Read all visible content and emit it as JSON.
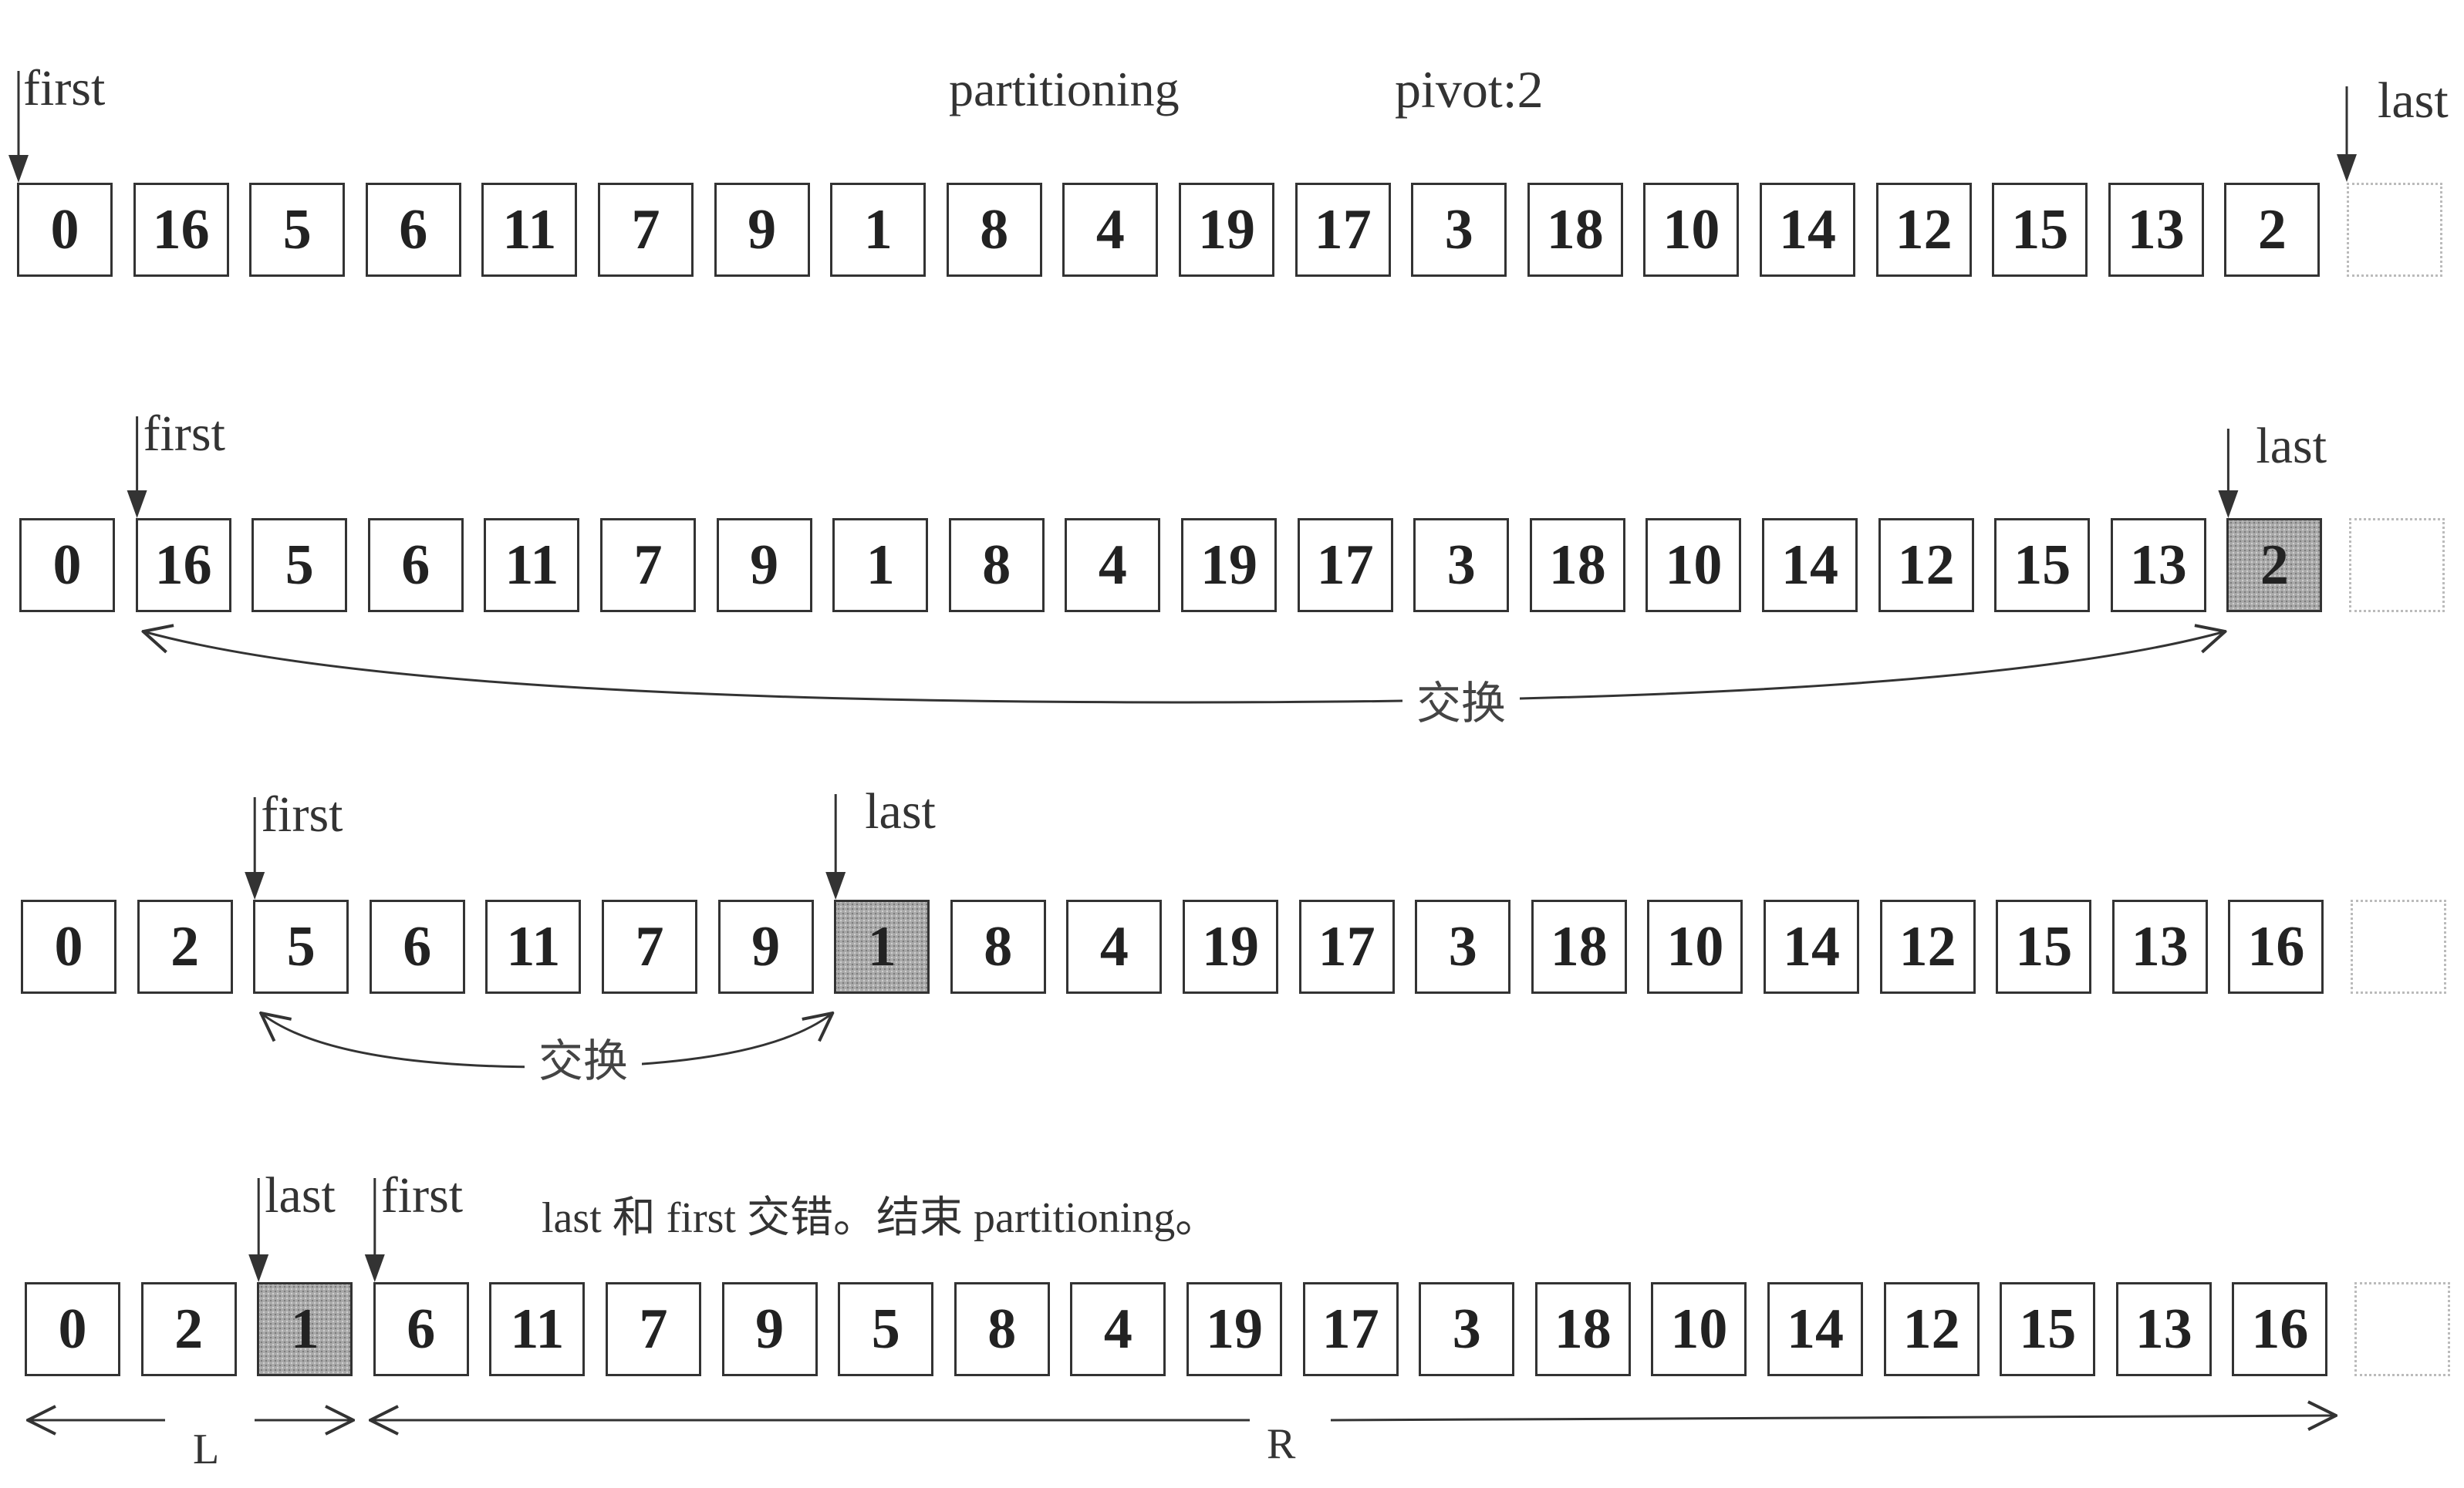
{
  "header": {
    "title": "partitioning",
    "pivot_label": "pivot:2"
  },
  "pointer_labels": {
    "first": "first",
    "last": "last"
  },
  "swap_label": "交换",
  "end_note": "last 和 first 交错。结束 partitioning。",
  "range_labels": {
    "left": "L",
    "right": "R"
  },
  "colors": {
    "box_border": "#333333",
    "shaded_fill": "#a9a9a9",
    "empty_border": "#bbbbbb",
    "arrow": "#333333"
  },
  "rows": [
    {
      "values": [
        0,
        16,
        5,
        6,
        11,
        7,
        9,
        1,
        8,
        4,
        19,
        17,
        3,
        18,
        10,
        14,
        12,
        15,
        13,
        2
      ],
      "shaded": [],
      "first_index": 0,
      "last_index": 20,
      "swap": null
    },
    {
      "values": [
        0,
        16,
        5,
        6,
        11,
        7,
        9,
        1,
        8,
        4,
        19,
        17,
        3,
        18,
        10,
        14,
        12,
        15,
        13,
        2
      ],
      "shaded": [
        19
      ],
      "first_index": 1,
      "last_index": 19,
      "swap": [
        1,
        19
      ]
    },
    {
      "values": [
        0,
        2,
        5,
        6,
        11,
        7,
        9,
        1,
        8,
        4,
        19,
        17,
        3,
        18,
        10,
        14,
        12,
        15,
        13,
        16
      ],
      "shaded": [
        7
      ],
      "first_index": 2,
      "last_index": 7,
      "swap": [
        2,
        7
      ]
    },
    {
      "values": [
        0,
        2,
        1,
        6,
        11,
        7,
        9,
        5,
        8,
        4,
        19,
        17,
        3,
        18,
        10,
        14,
        12,
        15,
        13,
        16
      ],
      "shaded": [
        2
      ],
      "first_index": 3,
      "last_index": 2,
      "swap": null,
      "ranges": {
        "L": [
          0,
          2
        ],
        "R": [
          3,
          19
        ]
      }
    }
  ]
}
